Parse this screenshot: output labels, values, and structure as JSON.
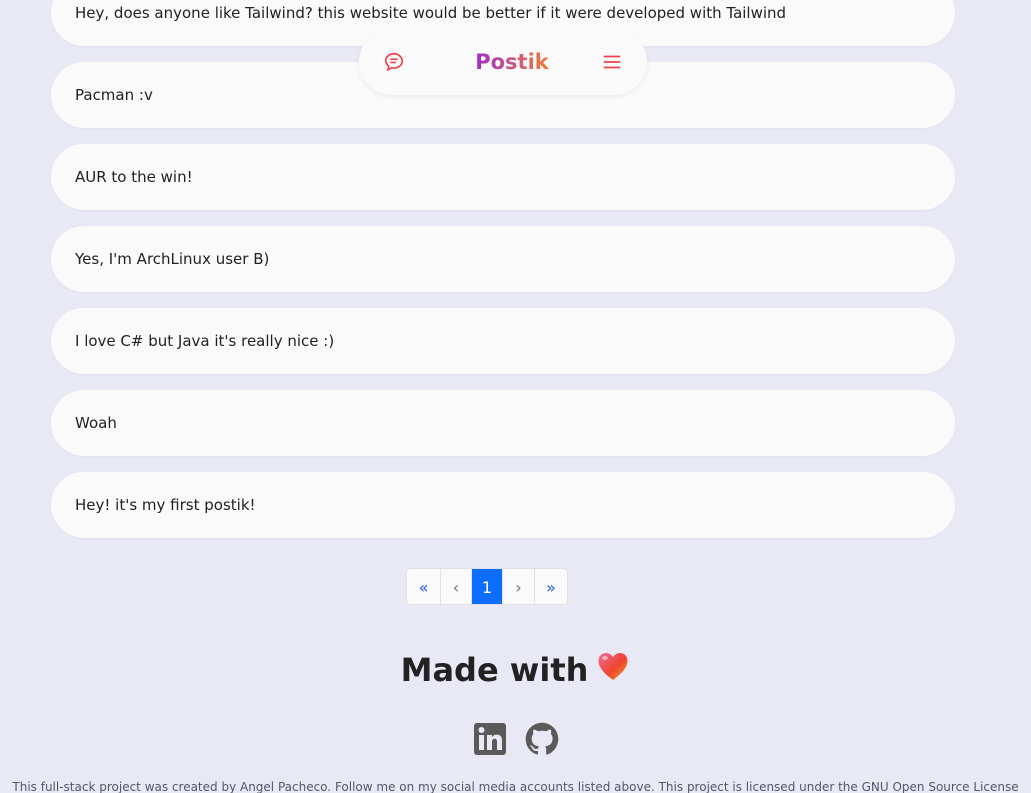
{
  "posts": [
    "Hey, does anyone like Tailwind? this website would be better if it were developed with Tailwind",
    "Pacman :v",
    "AUR to the win!",
    "Yes, I'm ArchLinux user B)",
    "I love C# but Java it's really nice :)",
    "Woah",
    "Hey! it's my first postik!"
  ],
  "navbar": {
    "brand": "Postik",
    "left_icon": "chat-bubble-icon",
    "right_icon": "hamburger-menu-icon",
    "accent_color": "#e8434b"
  },
  "pagination": {
    "first": "«",
    "prev": "‹",
    "current": "1",
    "next": "›",
    "last": "»"
  },
  "footer": {
    "made_with": "Made with",
    "heart_icon": "heart-icon",
    "social": [
      "linkedin-icon",
      "github-icon"
    ],
    "text": "This full-stack project was created by Angel Pacheco. Follow me on my social media accounts listed above. This project is licensed under the GNU Open Source License"
  }
}
